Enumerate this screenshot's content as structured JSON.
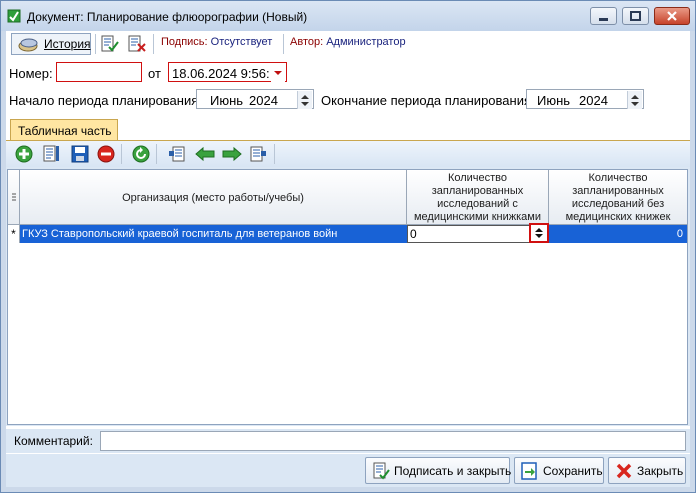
{
  "window": {
    "title": "Документ: Планирование флюорографии (Новый)"
  },
  "toolbar": {
    "history_label": "История",
    "sign_label": "Подпись:",
    "sign_value": "Отсутствует",
    "author_label": "Автор:",
    "author_value": "Администратор"
  },
  "form": {
    "number_label": "Номер:",
    "number_value": "",
    "from_label": "от",
    "date_value": "18.06.2024 9:56:",
    "period_start_label": "Начало периода планирования:",
    "period_start_month": "Июнь",
    "period_start_year": "2024",
    "period_end_label": "Окончание периода планирования:",
    "period_end_month": "Июнь",
    "period_end_year": "2024"
  },
  "tabs": [
    {
      "label": "Табличная часть",
      "active": true
    }
  ],
  "table_toolbar": {
    "icons": [
      "add-icon",
      "edit-icon",
      "save-row-icon",
      "delete-icon",
      "refresh-icon",
      "move-left-icon-a",
      "arrow-left-icon",
      "arrow-right-icon",
      "move-right-icon-b"
    ]
  },
  "grid": {
    "columns": [
      "Организация (место работы/учебы)",
      "Количество запланированных исследований с медицинскими книжками",
      "Количество запланированных исследований без медицинских книжек"
    ],
    "col2_lines": [
      "Количество",
      "запланированных",
      "исследований с",
      "медицинскими книжками"
    ],
    "col3_lines": [
      "Количество",
      "запланированных",
      "исследований без",
      "медицинских книжек"
    ],
    "rows": [
      {
        "marker": "*",
        "organization": "ГКУЗ Ставропольский краевой госпиталь для ветеранов войн",
        "with_books": "0",
        "without_books": "0"
      }
    ]
  },
  "comment": {
    "label": "Комментарий:",
    "value": ""
  },
  "buttons": {
    "sign_close": "Подписать и закрыть",
    "save": "Сохранить",
    "close": "Закрыть"
  },
  "colors": {
    "selection": "#1862d6",
    "tab_active": "#ffe6a2",
    "highlight_red": "#d01010",
    "panel_bg": "#dbe7f4"
  }
}
